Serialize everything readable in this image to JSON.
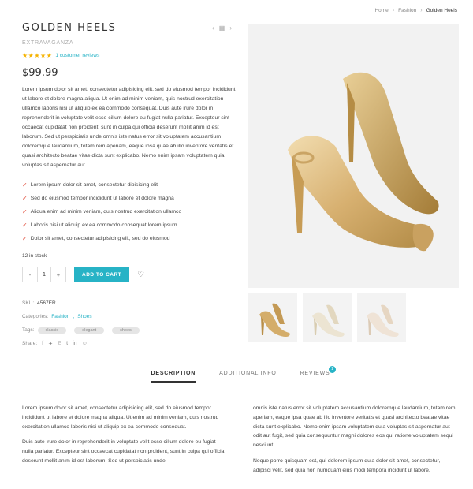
{
  "breadcrumb": {
    "home": "Home",
    "category": "Fashion",
    "current": "Golden Heels"
  },
  "product": {
    "title": "GOLDEN HEELS",
    "brand": "EXTRAVAGANZA",
    "stars": "★★★★★",
    "reviews_link": "1 customer reviews",
    "price": "$99.99",
    "description": "Lorem ipsum dolor sit amet, consectetur adipisicing elit, sed do eiusmod tempor incididunt ut labore et dolore magna aliqua. Ut enim ad minim veniam, quis nostrud exercitation ullamco laboris nisi ut aliquip ex ea commodo consequat. Duis aute irure dolor in reprehenderit in voluptate velit esse cillum dolore eu fugiat nulla pariatur. Excepteur sint occaecat cupidatat non proident, sunt in culpa qui officia deserunt mollit anim id est laborum. Sed ut perspiciatis unde omnis iste natus error sit voluptatem accusantium doloremque laudantium, totam rem aperiam, eaque ipsa quae ab illo inventore veritatis et quasi architecto beatae vitae dicta sunt explicabo. Nemo enim ipsam voluptatem quia voluptas sit aspernatur aut",
    "features": [
      "Lorem ipsum dolor sit amet, consectetur dipisicing elit",
      "Sed do eiusmod tempor incididunt ut labore et dolore magna",
      "Aliqua enim ad minim veniam, quis nostrud exercitation ullamco",
      "Laboris nisi ut aliquip ex ea commodo consequat lorem ipsum",
      "Dolor sit amet, consectetur adipisicing elit, sed do eiusmod"
    ],
    "stock": "12 in stock",
    "quantity": "1",
    "qty_minus": "-",
    "qty_plus": "+",
    "add_to_cart": "ADD TO CART",
    "sku_label": "SKU:",
    "sku": "4567ER.",
    "categories_label": "Categories:",
    "categories": [
      "Fashion",
      "Shoes"
    ],
    "tags_label": "Tags:",
    "tags": [
      "classic",
      "elegant",
      "shoes"
    ],
    "share_label": "Share:"
  },
  "tabs": [
    {
      "label": "DESCRIPTION"
    },
    {
      "label": "ADDITIONAL INFO"
    },
    {
      "label": "REVIEWS",
      "badge": "1"
    }
  ],
  "tab_content": {
    "col1_p1": "Lorem ipsum dolor sit amet, consectetur adipisicing elit, sed do eiusmod tempor incididunt ut labore et dolore magna aliqua. Ut enim ad minim veniam, quis nostrud exercitation ullamco laboris nisi ut aliquip ex ea commodo consequat.",
    "col1_p2": "Duis aute irure dolor in reprehenderit in voluptate velit esse cillum dolore eu fugiat nulla pariatur. Excepteur sint occaecat cupidatat non proident, sunt in culpa qui officia deserunt mollit anim id est laborum. Sed ut perspiciatis unde",
    "col2_p1": "omnis iste natus error sit voluptatem accusantium doloremque laudantium, totam rem aperiam, eaque ipsa quae ab illo inventore veritatis et quasi architecto beatae vitae dicta sunt explicabo. Nemo enim ipsam voluptatem quia voluptas sit aspernatur aut odit aut fugit, sed quia consequuntur magni dolores eos qui ratione voluptatem sequi nesciunt.",
    "col2_p2": "Neque porro quisquam est, qui dolorem ipsum quia dolor sit amet, consectetur, adipisci velit, sed quia non numquam eius modi tempora incidunt ut labore."
  },
  "colors": {
    "accent": "#27b3c6",
    "star": "#f5b301",
    "check": "#e24e3c"
  },
  "icons": [
    "chevron-left-icon",
    "grid-icon",
    "chevron-right-icon",
    "heart-icon",
    "facebook-icon",
    "twitter-icon",
    "pinterest-icon",
    "tumblr-icon",
    "linkedin-icon",
    "reddit-icon",
    "check-icon"
  ]
}
